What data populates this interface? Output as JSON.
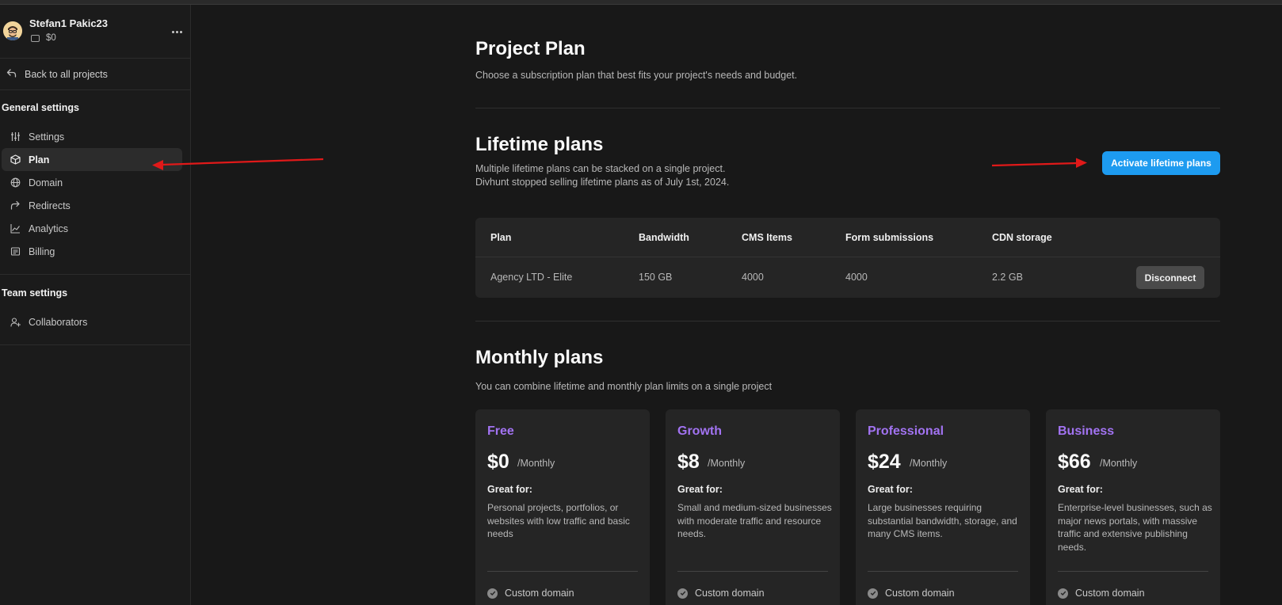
{
  "sidebar": {
    "user_name": "Stefan1 Pakic23",
    "balance": "$0",
    "back_label": "Back to all projects",
    "general_title": "General settings",
    "general_items": [
      {
        "label": "Settings",
        "icon": "sliders-icon"
      },
      {
        "label": "Plan",
        "icon": "cube-icon"
      },
      {
        "label": "Domain",
        "icon": "globe-icon"
      },
      {
        "label": "Redirects",
        "icon": "redirect-arrow-icon"
      },
      {
        "label": "Analytics",
        "icon": "chart-icon"
      },
      {
        "label": "Billing",
        "icon": "receipt-icon"
      }
    ],
    "active_item": "Plan",
    "team_title": "Team settings",
    "team_items": [
      {
        "label": "Collaborators",
        "icon": "user-add-icon"
      }
    ]
  },
  "main": {
    "title": "Project Plan",
    "subtitle": "Choose a subscription plan that best fits your project's needs and budget.",
    "lifetime": {
      "title": "Lifetime plans",
      "desc_line1": "Multiple lifetime plans can be stacked on a single project.",
      "desc_line2": "Divhunt stopped selling lifetime plans as of July 1st, 2024.",
      "activate_label": "Activate lifetime plans",
      "columns": [
        "Plan",
        "Bandwidth",
        "CMS Items",
        "Form submissions",
        "CDN storage"
      ],
      "rows": [
        {
          "plan": "Agency LTD - Elite",
          "bandwidth": "150 GB",
          "cms": "4000",
          "forms": "4000",
          "cdn": "2.2 GB",
          "action": "Disconnect"
        }
      ]
    },
    "monthly": {
      "title": "Monthly plans",
      "subtitle": "You can combine lifetime and monthly plan limits on a single project",
      "plans": [
        {
          "name": "Free",
          "price": "$0",
          "period": "/Monthly",
          "great_for": "Great for:",
          "desc": "Personal projects, portfolios, or websites with low traffic and basic needs",
          "feature": "Custom domain"
        },
        {
          "name": "Growth",
          "price": "$8",
          "period": "/Monthly",
          "great_for": "Great for:",
          "desc": "Small and medium-sized businesses with moderate traffic and resource needs.",
          "feature": "Custom domain"
        },
        {
          "name": "Professional",
          "price": "$24",
          "period": "/Monthly",
          "great_for": "Great for:",
          "desc": "Large businesses requiring substantial bandwidth, storage, and many CMS items.",
          "feature": "Custom domain"
        },
        {
          "name": "Business",
          "price": "$66",
          "period": "/Monthly",
          "great_for": "Great for:",
          "desc": "Enterprise-level businesses, such as major news portals, with massive traffic and extensive publishing needs.",
          "feature": "Custom domain"
        }
      ]
    }
  },
  "colors": {
    "accent": "#1d9bf0",
    "plan_name": "#a273f2",
    "annotation_arrow": "#e01919"
  }
}
